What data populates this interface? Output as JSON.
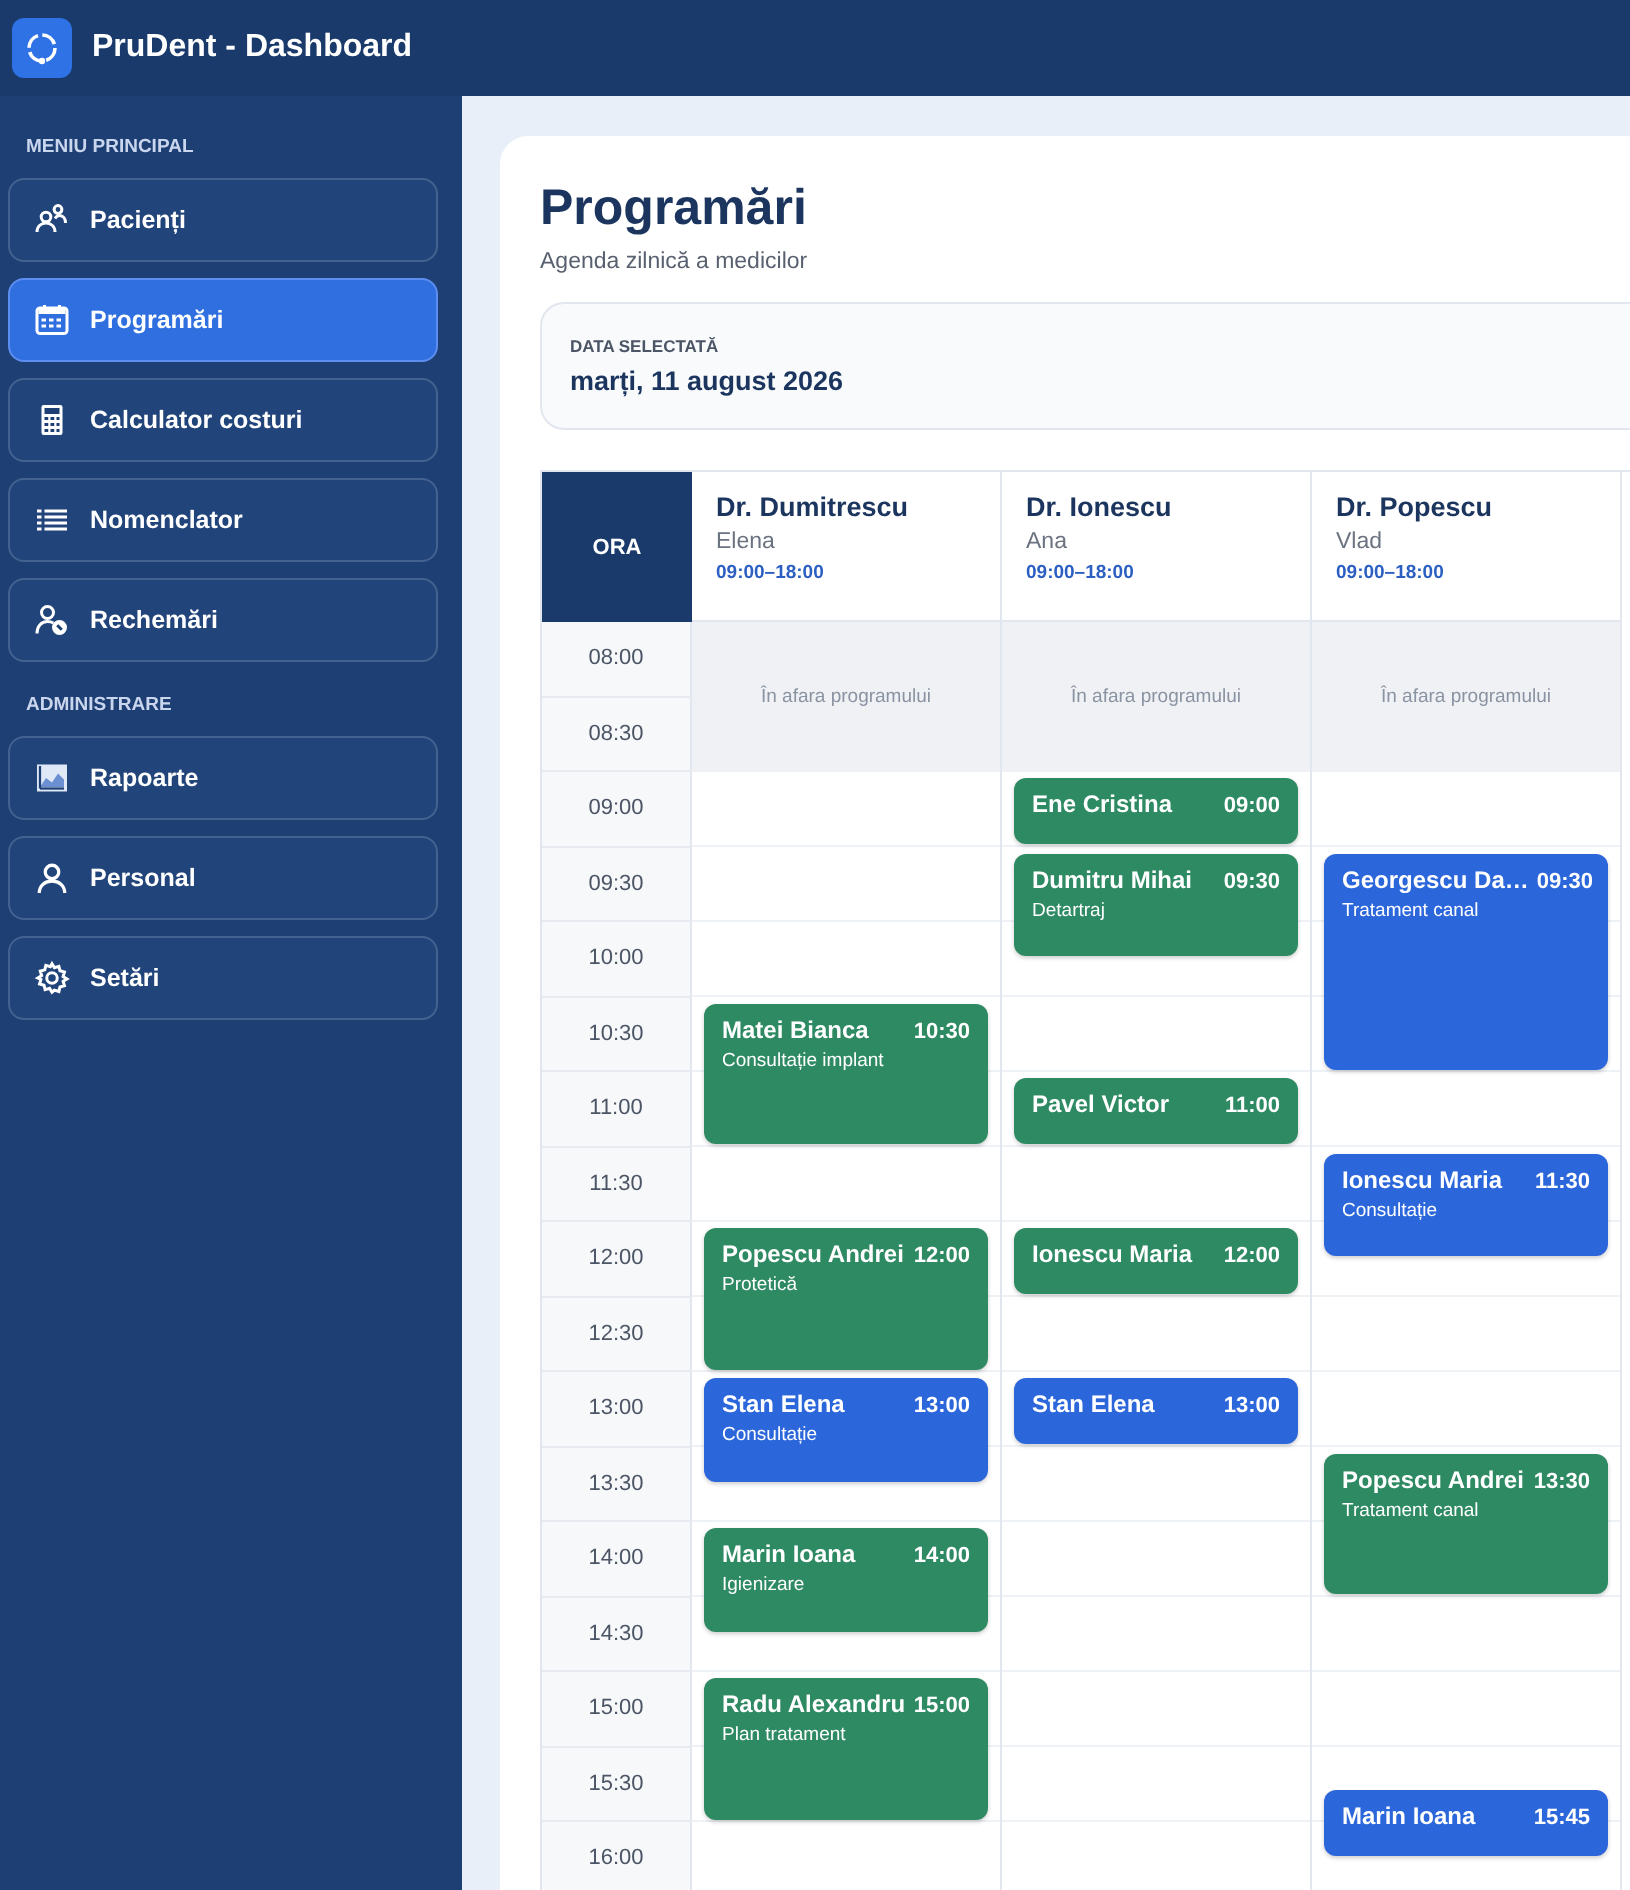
{
  "app_bar": {
    "title": "PruDent - Dashboard"
  },
  "sidebar": {
    "sections": [
      {
        "label": "MENIU PRINCIPAL",
        "items": [
          {
            "label": "Pacienți",
            "selected": false
          },
          {
            "label": "Programări",
            "selected": true
          },
          {
            "label": "Calculator costuri",
            "selected": false
          },
          {
            "label": "Nomenclator",
            "selected": false
          },
          {
            "label": "Rechemări",
            "selected": false
          }
        ]
      },
      {
        "label": "ADMINISTRARE",
        "items": [
          {
            "label": "Rapoarte",
            "selected": false
          },
          {
            "label": "Personal",
            "selected": false
          },
          {
            "label": "Setări",
            "selected": false
          }
        ]
      }
    ]
  },
  "page": {
    "title": "Programări",
    "subtitle": "Agenda zilnică a medicilor"
  },
  "date_panel": {
    "label": "DATA SELECTATĂ",
    "value": "marți, 11 august 2026"
  },
  "schedule": {
    "time_header": "ORA",
    "times": [
      "08:00",
      "08:30",
      "09:00",
      "09:30",
      "10:00",
      "10:30",
      "11:00",
      "11:30",
      "12:00",
      "12:30",
      "13:00",
      "13:30",
      "14:00",
      "14:30",
      "15:00",
      "15:30",
      "16:00"
    ],
    "doctors": [
      {
        "name": "Dr. Dumitrescu",
        "first_name": "Elena",
        "hours": "09:00–18:00",
        "closed_label": "În afara programului",
        "appointments": [
          {
            "patient": "Matei Bianca",
            "time": "10:30",
            "service": "Consultație implant",
            "kind": "long",
            "color": "#2e8a63"
          },
          {
            "patient": "Popescu Andrei",
            "time": "12:00",
            "service": "Protetică",
            "kind": "long",
            "color": "#2e8a63"
          },
          {
            "patient": "Stan Elena",
            "time": "13:00",
            "service": "Consultație",
            "kind": "medium",
            "color": "#2b66db"
          },
          {
            "patient": "Marin Ioana",
            "time": "14:00",
            "service": "Igienizare",
            "kind": "medium",
            "color": "#2e8a63"
          },
          {
            "patient": "Radu Alexandru",
            "time": "15:00",
            "service": "Plan tratament",
            "kind": "long",
            "color": "#2e8a63"
          }
        ]
      },
      {
        "name": "Dr. Ionescu",
        "first_name": "Ana",
        "hours": "09:00–18:00",
        "closed_label": "În afara programului",
        "appointments": [
          {
            "patient": "Ene Cristina",
            "time": "09:00",
            "kind": "short",
            "color": "#2e8a63"
          },
          {
            "patient": "Dumitru Mihai",
            "time": "09:30",
            "service": "Detartraj",
            "kind": "medium",
            "color": "#2e8a63"
          },
          {
            "patient": "Pavel Victor",
            "time": "11:00",
            "kind": "short",
            "color": "#2e8a63"
          },
          {
            "patient": "Ionescu Maria",
            "time": "12:00",
            "kind": "short",
            "color": "#2e8a63"
          },
          {
            "patient": "Stan Elena",
            "time": "13:00",
            "kind": "short",
            "color": "#2b66db"
          }
        ]
      },
      {
        "name": "Dr. Popescu",
        "first_name": "Vlad",
        "hours": "09:00–18:00",
        "closed_label": "În afara programului",
        "appointments": [
          {
            "patient": "Georgescu Da…",
            "time": "09:30",
            "service": "Tratament canal",
            "kind": "extended",
            "color": "#2b66db"
          },
          {
            "patient": "Ionescu Maria",
            "time": "11:30",
            "service": "Consultație",
            "kind": "medium",
            "color": "#2b66db"
          },
          {
            "patient": "Popescu Andrei",
            "time": "13:30",
            "service": "Tratament canal",
            "kind": "long",
            "color": "#2e8a63"
          },
          {
            "patient": "Marin Ioana",
            "time": "15:45",
            "kind": "short",
            "color": "#2b66db"
          }
        ]
      }
    ]
  }
}
